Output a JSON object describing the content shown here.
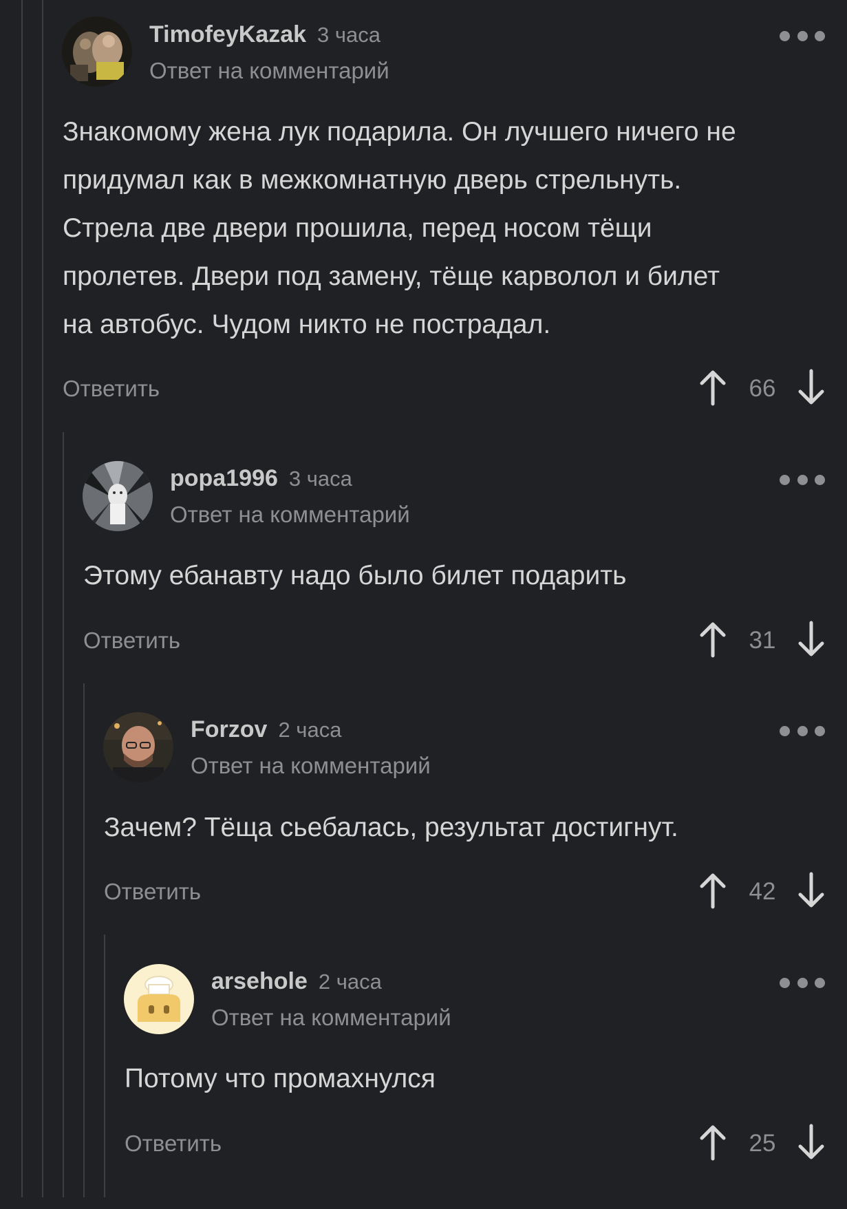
{
  "comments": [
    {
      "username": "TimofeyKazak",
      "time": "3 часа",
      "reply_note": "Ответ на комментарий",
      "avatar": "pigs-photo-avatar",
      "text_lines": [
        "Знакомому жена лук подарила. Он лучшего ничего не",
        "придумал как в межкомнатную дверь стрельнуть.",
        "Стрела две двери прошила, перед носом тёщи",
        "пролетев. Двери под замену, тёще карволол и билет",
        "на автобус. Чудом никто не пострадал."
      ],
      "reply_label": "Ответить",
      "score": "66"
    },
    {
      "username": "popa1996",
      "time": "3 часа",
      "reply_note": "Ответ на комментарий",
      "avatar": "cat-photo-avatar",
      "text_lines": [
        "Этому ебанавту надо было билет подарить"
      ],
      "reply_label": "Ответить",
      "score": "31"
    },
    {
      "username": "Forzov",
      "time": "2 часа",
      "reply_note": "Ответ на комментарий",
      "avatar": "man-photo-avatar",
      "text_lines": [
        "Зачем? Тёща сьебалась, результат достигнут."
      ],
      "reply_label": "Ответить",
      "score": "42"
    },
    {
      "username": "arsehole",
      "time": "2 часа",
      "reply_note": "Ответ на комментарий",
      "avatar": "default-chef-avatar",
      "text_lines": [
        "Потому что промахнулся"
      ],
      "reply_label": "Ответить",
      "score": "25"
    }
  ],
  "icons": {
    "more": "more-dots-icon",
    "upvote": "arrow-up-icon",
    "downvote": "arrow-down-icon"
  },
  "colors": {
    "background": "#202124",
    "text": "#d6d6d6",
    "muted": "#8e8f93",
    "thread_line": "#3d3e41"
  }
}
